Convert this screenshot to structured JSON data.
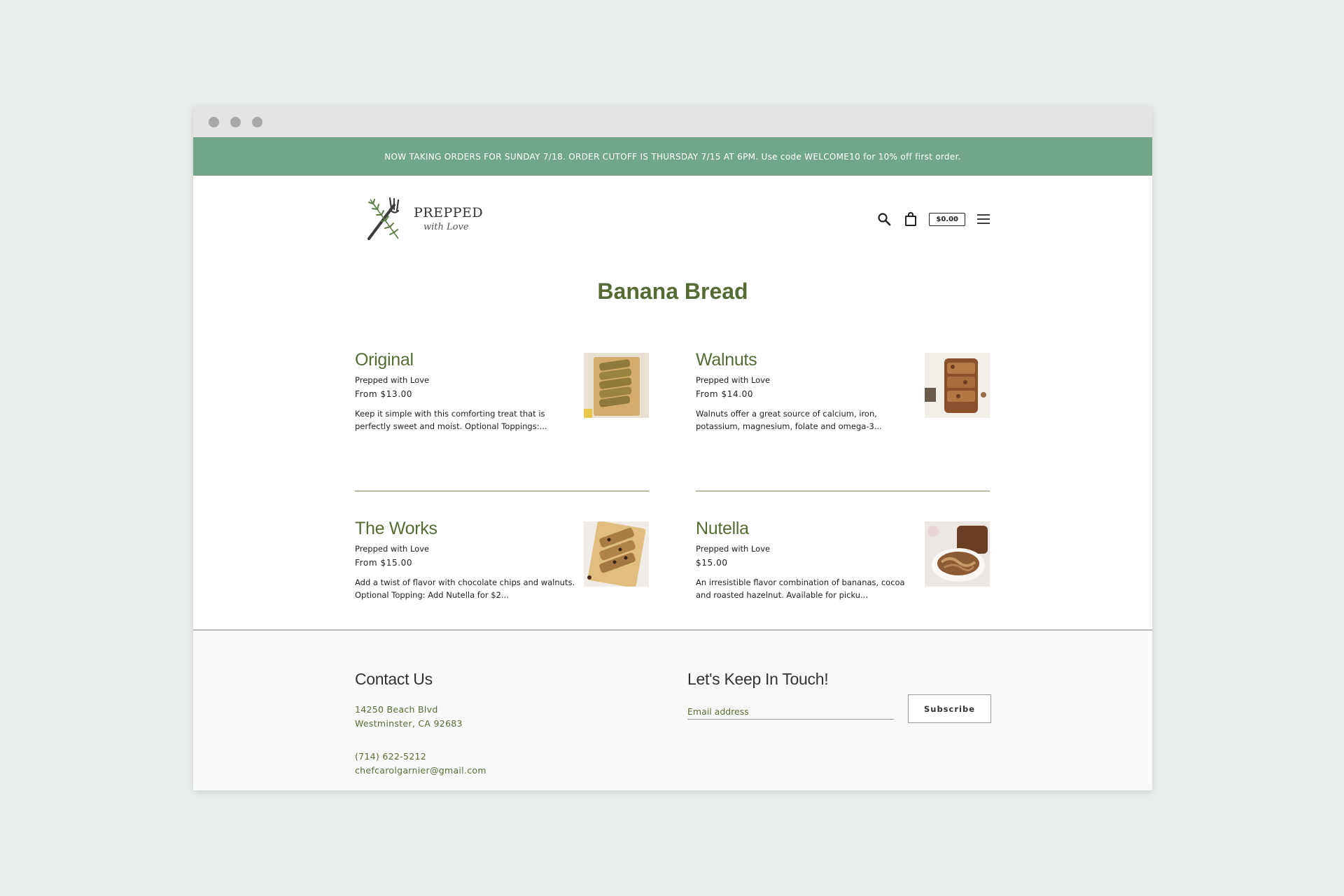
{
  "announcement": "NOW TAKING ORDERS FOR SUNDAY 7/18. ORDER CUTOFF IS THURSDAY 7/15 AT 6PM. Use code WELCOME10 for 10% off first order.",
  "brand": {
    "name": "PREPPED",
    "tagline": "with Love"
  },
  "header": {
    "cart_total": "$0.00"
  },
  "page_title": "Banana Bread",
  "products": [
    {
      "title": "Original",
      "vendor": "Prepped with Love",
      "price": "From $13.00",
      "description": "Keep it simple with this comforting treat that is perfectly sweet and moist. Optional Toppings:..."
    },
    {
      "title": "Walnuts",
      "vendor": "Prepped with Love",
      "price": "From $14.00",
      "description": "Walnuts offer a great source of calcium, iron, potassium, magnesium, folate and omega-3..."
    },
    {
      "title": "The Works",
      "vendor": "Prepped with Love",
      "price": "From $15.00",
      "description": "Add a twist of flavor with chocolate chips and walnuts. Optional Topping: Add Nutella for $2..."
    },
    {
      "title": "Nutella",
      "vendor": "Prepped with Love",
      "price": "$15.00",
      "description": "An irresistible flavor combination of bananas, cocoa and roasted hazelnut. Available for picku..."
    }
  ],
  "footer": {
    "contact_heading": "Contact Us",
    "address_line1": "14250 Beach Blvd",
    "address_line2": "Westminster, CA 92683",
    "phone": "(714) 622-5212",
    "email": "chefcarolgarnier@gmail.com",
    "newsletter_heading": "Let's Keep In Touch!",
    "email_placeholder": "Email address",
    "subscribe_label": "Subscribe"
  },
  "colors": {
    "announcement_bg": "#72a68a",
    "accent_green": "#566b34",
    "page_bg": "#e9eeea"
  },
  "icons": [
    "search-icon",
    "cart-icon",
    "hamburger-menu-icon",
    "fork-rosemary-logo-icon"
  ]
}
